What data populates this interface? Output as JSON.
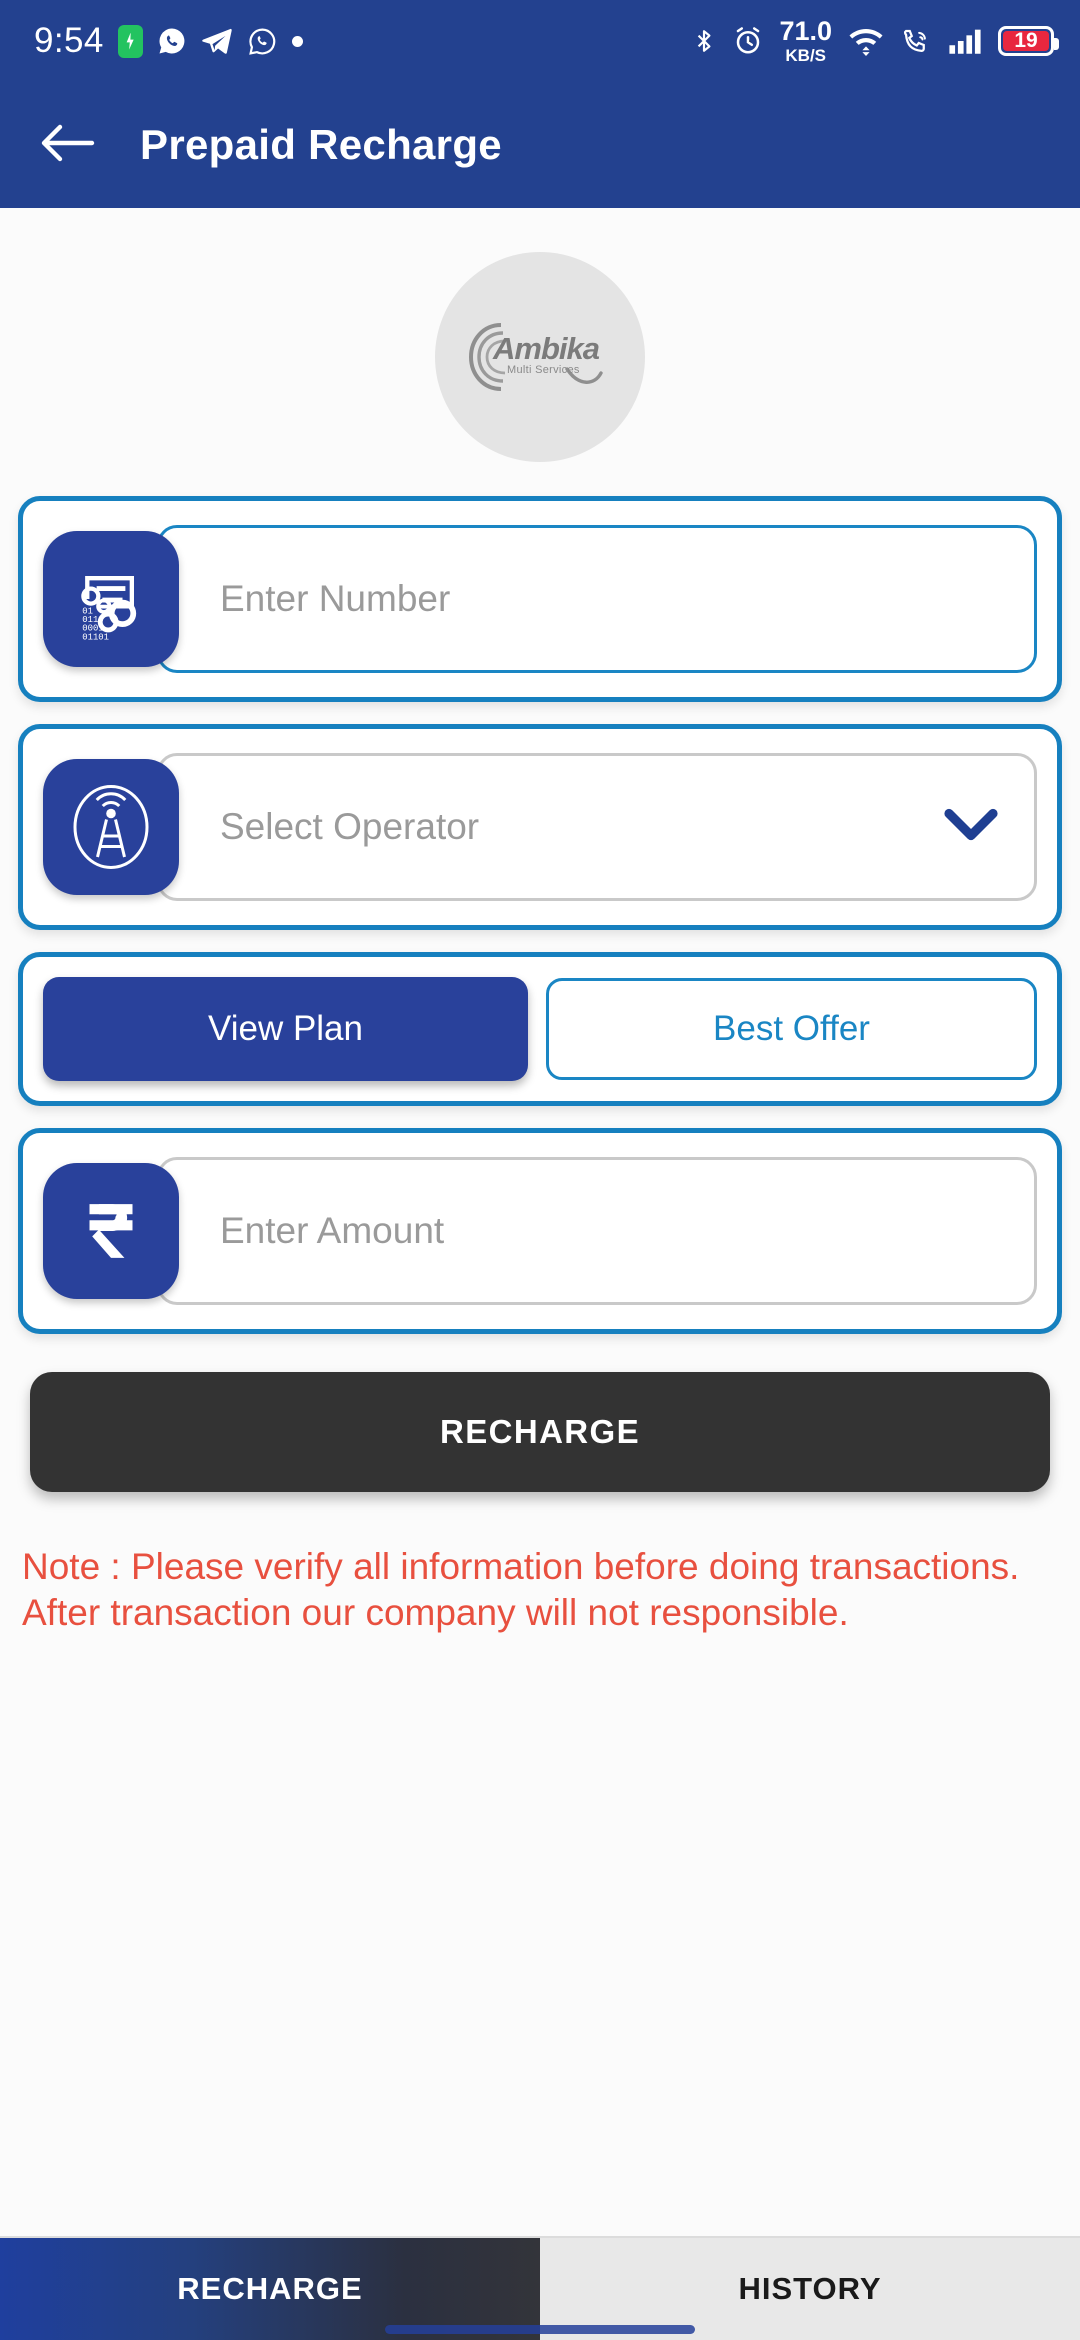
{
  "status_bar": {
    "time": "9:54",
    "left_icons": [
      "battery-charging-icon",
      "whatsapp-business-icon",
      "telegram-icon",
      "whatsapp-icon",
      "dot-icon"
    ],
    "network_speed_value": "71.0",
    "network_speed_unit": "KB/S",
    "right_icons": [
      "bluetooth-icon",
      "alarm-icon",
      "wifi-icon",
      "vowifi-call-icon",
      "signal-bars-icon"
    ],
    "battery_percent": "19"
  },
  "app_bar": {
    "back_label": "back-arrow",
    "title": "Prepaid Recharge"
  },
  "brand": {
    "logo_name": "Ambika",
    "logo_tagline": "Multi Services"
  },
  "form": {
    "number_field": {
      "placeholder": "Enter Number",
      "value": "",
      "icon": "recharge-code-icon",
      "icon_binary_lines": [
        "01",
        "0110",
        "0001",
        "01101"
      ]
    },
    "operator_field": {
      "placeholder": "Select Operator",
      "value": "",
      "icon": "cell-tower-icon",
      "chevron": "chevron-down-icon"
    },
    "plan_buttons": {
      "view_plan_label": "View Plan",
      "best_offer_label": "Best Offer"
    },
    "amount_field": {
      "placeholder": "Enter Amount",
      "value": "",
      "icon": "rupee-icon",
      "currency_symbol": "₹"
    },
    "submit_label": "RECHARGE"
  },
  "note": "Note : Please verify all information before doing transactions. After transaction our company will not responsible.",
  "bottom_tabs": [
    {
      "label": "RECHARGE",
      "active": true
    },
    {
      "label": "HISTORY",
      "active": false
    }
  ],
  "colors": {
    "brand_blue": "#23418f",
    "icon_blue": "#29419b",
    "accent_teal": "#1680bf",
    "note_red": "#e8503f",
    "submit_dark": "#333333"
  }
}
